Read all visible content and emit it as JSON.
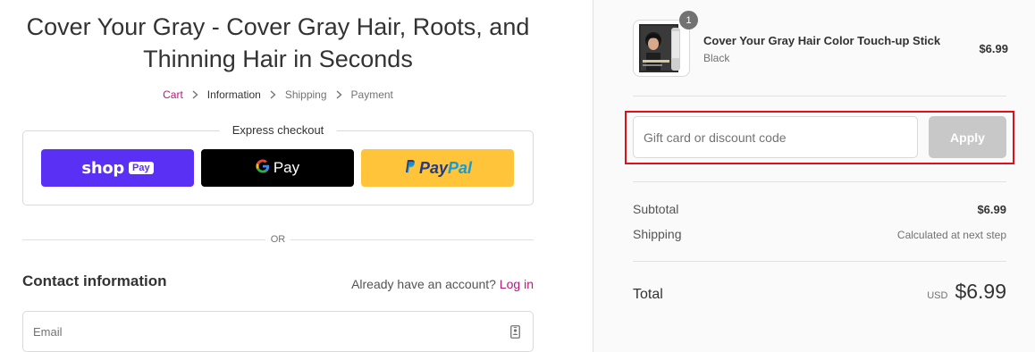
{
  "store": {
    "title": "Cover Your Gray - Cover Gray Hair, Roots, and Thinning Hair in Seconds"
  },
  "breadcrumb": [
    {
      "label": "Cart",
      "state": "link"
    },
    {
      "label": "Information",
      "state": "current"
    },
    {
      "label": "Shipping",
      "state": "upcoming"
    },
    {
      "label": "Payment",
      "state": "upcoming"
    }
  ],
  "express_checkout": {
    "title": "Express checkout",
    "buttons": {
      "shop_word": "shop",
      "shop_badge": "Pay",
      "gpay_word": "Pay",
      "paypal_pay": "Pay",
      "paypal_pal": "Pal"
    }
  },
  "divider": {
    "or_label": "OR"
  },
  "contact": {
    "title": "Contact information",
    "account_prompt": "Already have an account?",
    "login_label": "Log in",
    "email_placeholder": "Email",
    "email_value": ""
  },
  "order_summary": {
    "product": {
      "name": "Cover Your Gray Hair Color Touch-up Stick",
      "variant": "Black",
      "price": "$6.99",
      "quantity": "1"
    },
    "discount": {
      "placeholder": "Gift card or discount code",
      "value": "",
      "apply_label": "Apply"
    },
    "subtotal_label": "Subtotal",
    "subtotal_value": "$6.99",
    "shipping_label": "Shipping",
    "shipping_value": "Calculated at next step",
    "total_label": "Total",
    "currency": "USD",
    "total_value": "$6.99"
  },
  "colors": {
    "link_accent": "#b01c7a",
    "shop_pay_purple": "#5a31f4",
    "gpay_black": "#000000",
    "paypal_yellow": "#ffc439",
    "highlight_red": "#e0101a",
    "apply_disabled": "#c8c8c8"
  },
  "icons": [
    "chevron-right-icon",
    "google-g-icon",
    "paypal-p-icon",
    "contact-card-icon"
  ]
}
